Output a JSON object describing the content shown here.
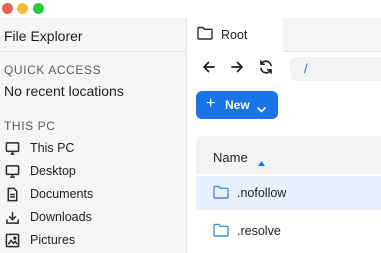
{
  "window": {
    "controls": [
      "close",
      "minimize",
      "maximize"
    ],
    "colors": {
      "close": "#f25f57",
      "minimize": "#f8bd2e",
      "maximize": "#29c840"
    }
  },
  "sidebar": {
    "app_title": "File Explorer",
    "quick_access": {
      "heading": "QUICK ACCESS",
      "empty_text": "No recent locations"
    },
    "this_pc": {
      "heading": "THIS PC",
      "items": [
        {
          "label": "This PC",
          "icon": "monitor-icon"
        },
        {
          "label": "Desktop",
          "icon": "desktop-icon"
        },
        {
          "label": "Documents",
          "icon": "document-icon"
        },
        {
          "label": "Downloads",
          "icon": "download-icon"
        },
        {
          "label": "Pictures",
          "icon": "image-icon"
        }
      ]
    }
  },
  "tabs": [
    {
      "label": "Root",
      "icon": "folder-icon",
      "active": true
    }
  ],
  "toolbar": {
    "back_icon": "arrow-left-icon",
    "forward_icon": "arrow-right-icon",
    "refresh_icon": "refresh-icon",
    "path": "/"
  },
  "actions": {
    "new_label": "New",
    "new_icon": "plus-icon",
    "accent_color": "#1a73e8"
  },
  "file_list": {
    "columns": [
      {
        "label": "Name",
        "sort": "ascending"
      }
    ],
    "rows": [
      {
        "name": ".nofollow",
        "icon": "folder-icon",
        "selected": true
      },
      {
        "name": ".resolve",
        "icon": "folder-icon",
        "selected": false
      }
    ]
  }
}
